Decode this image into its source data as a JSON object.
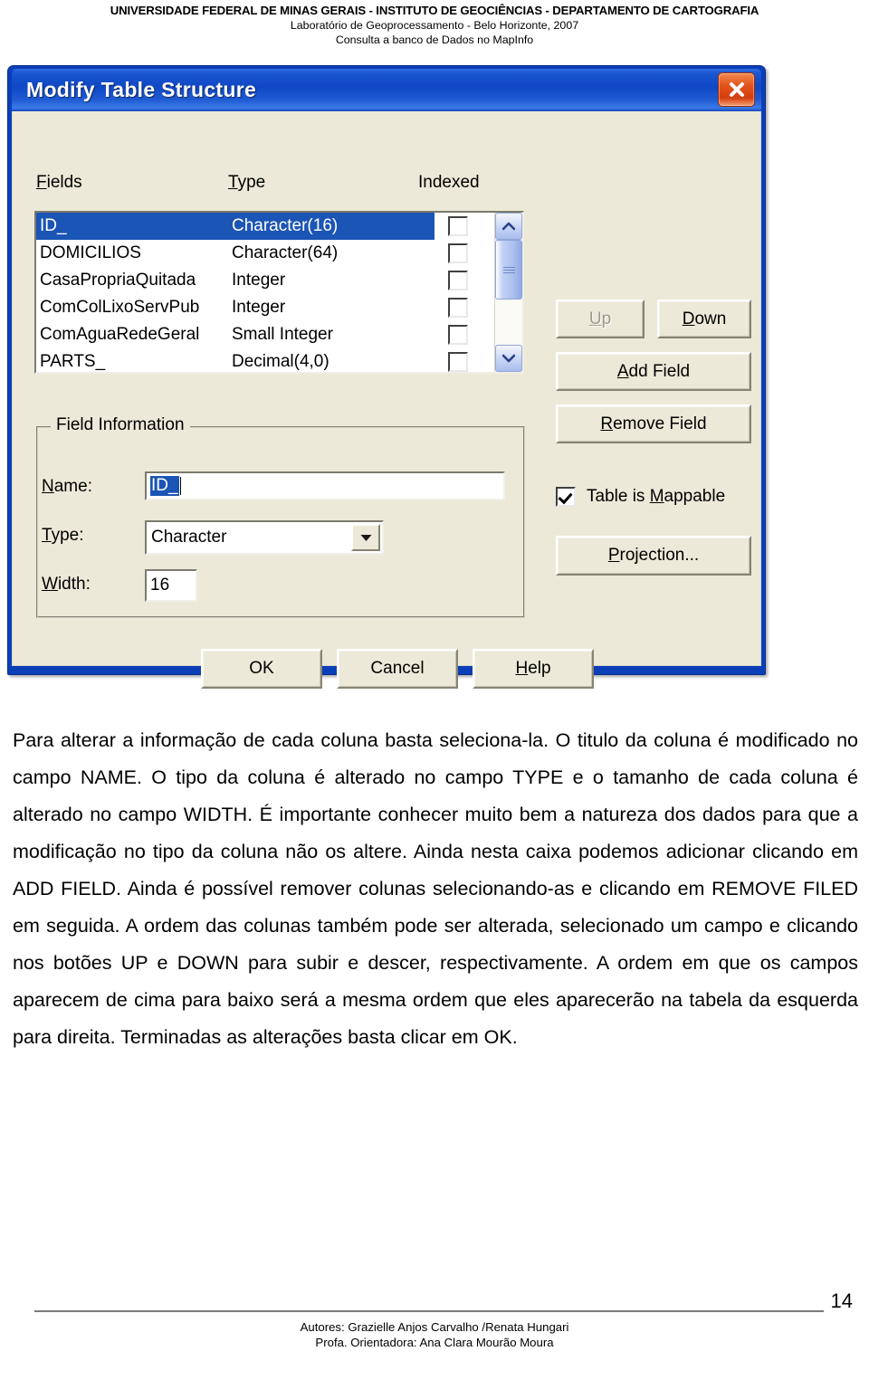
{
  "page_header": {
    "line1": "UNIVERSIDADE FEDERAL DE MINAS GERAIS - INSTITUTO DE GEOCIÊNCIAS - DEPARTAMENTO DE CARTOGRAFIA",
    "line2": "Laboratório de Geoprocessamento - Belo Horizonte, 2007",
    "line3": "Consulta a banco de Dados no MapInfo"
  },
  "dialog": {
    "title": "Modify Table Structure",
    "close_icon": "close-icon",
    "columns": {
      "fields": "Fields",
      "fields_accel": "F",
      "type": "Type",
      "type_accel": "T",
      "indexed": "Indexed"
    },
    "field_rows": [
      {
        "name": "ID_",
        "type": "Character(16)",
        "indexed": false,
        "selected": true
      },
      {
        "name": "DOMICILIOS",
        "type": "Character(64)",
        "indexed": false,
        "selected": false
      },
      {
        "name": "CasaPropriaQuitada",
        "type": "Integer",
        "indexed": false,
        "selected": false
      },
      {
        "name": "ComColLixoServPub",
        "type": "Integer",
        "indexed": false,
        "selected": false
      },
      {
        "name": "ComAguaRedeGeral",
        "type": "Small Integer",
        "indexed": false,
        "selected": false
      },
      {
        "name": "PARTS_",
        "type": "Decimal(4,0)",
        "indexed": false,
        "selected": false
      }
    ],
    "scrollbar": {
      "up_icon": "chevron-up-icon",
      "down_icon": "chevron-down-icon",
      "thumb_icon": "scroll-grip-icon"
    },
    "buttons": {
      "up": {
        "label": "Up",
        "accel": "U",
        "disabled": true
      },
      "down": {
        "label": "Down",
        "accel": "D",
        "disabled": false
      },
      "add_field": {
        "label": "Add Field",
        "accel": "A",
        "disabled": false
      },
      "remove_field": {
        "label": "Remove Field",
        "accel": "R",
        "disabled": false
      },
      "projection": {
        "label": "Projection...",
        "accel": "P",
        "disabled": false
      },
      "ok": {
        "label": "OK",
        "accel": "",
        "disabled": false
      },
      "cancel": {
        "label": "Cancel",
        "accel": "",
        "disabled": false
      },
      "help": {
        "label": "Help",
        "accel": "H",
        "disabled": false
      }
    },
    "mappable": {
      "label": "Table is Mappable",
      "accel": "M",
      "checked": true
    },
    "field_information": {
      "legend": "Field Information",
      "name_label": "Name:",
      "name_accel": "N",
      "name_value": "ID_",
      "type_label": "Type:",
      "type_accel": "T",
      "type_value": "Character",
      "type_dropdown_icon": "caret-down-icon",
      "width_label": "Width:",
      "width_accel": "W",
      "width_value": "16"
    },
    "colors": {
      "titlebar_blue": "#0f47c4",
      "selection_blue": "#1b55b5",
      "dialog_face": "#ece9d8",
      "close_red": "#e5561f"
    }
  },
  "body": {
    "paragraph": "Para alterar a informação de cada coluna basta seleciona-la. O titulo da coluna é modificado no campo NAME. O tipo da coluna é alterado no campo TYPE e o tamanho de cada coluna é alterado no campo WIDTH. É importante conhecer muito bem a natureza dos dados para que a modificação no tipo da coluna não os altere. Ainda nesta caixa podemos adicionar clicando em ADD FIELD. Ainda é possível remover colunas selecionando-as e clicando em REMOVE FILED em seguida. A ordem das colunas também pode ser alterada, selecionado um campo e clicando nos botões UP e DOWN para subir e descer, respectivamente. A ordem em que os campos aparecem de cima para baixo será a mesma ordem que eles aparecerão na tabela da esquerda para direita. Terminadas as alterações basta clicar em OK."
  },
  "footer": {
    "page_number": "14",
    "authors": "Autores: Grazielle Anjos Carvalho /Renata Hungari",
    "advisor": "Profa. Orientadora: Ana Clara Mourão Moura"
  }
}
